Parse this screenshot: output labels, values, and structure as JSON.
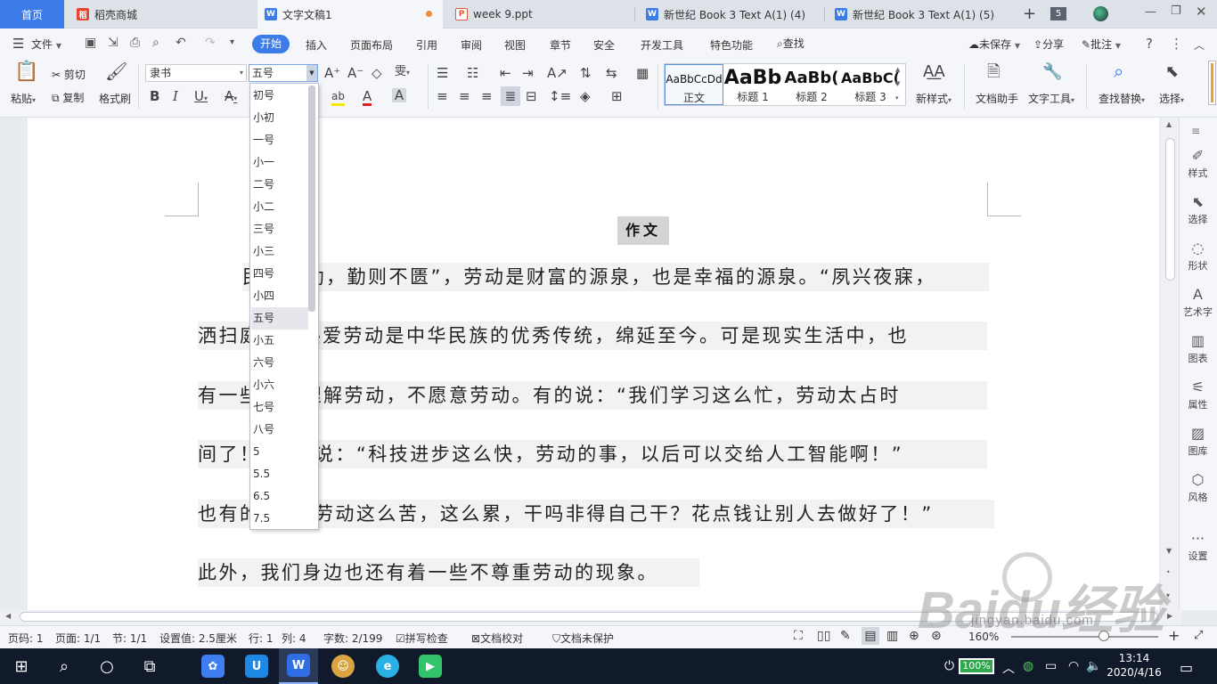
{
  "tabs": {
    "home": "首页",
    "daoke": "稻壳商城",
    "doc1": "文字文稿1",
    "ppt": "week 9.ppt",
    "book1": "新世纪 Book 3 Text A(1) (4)",
    "book2": "新世纪 Book 3 Text A(1) (5)",
    "new_tab": "+",
    "count": "5"
  },
  "menu": {
    "file": "文件",
    "start": "开始",
    "insert": "插入",
    "layout": "页面布局",
    "reference": "引用",
    "review": "审阅",
    "view": "视图",
    "chapter": "章节",
    "security": "安全",
    "dev": "开发工具",
    "special": "特色功能",
    "search": "查找",
    "unsaved": "未保存",
    "share": "分享",
    "annotate": "批注"
  },
  "ribbon": {
    "paste": "粘贴",
    "cut": "剪切",
    "copy": "复制",
    "format_painter": "格式刷",
    "font_name": "隶书",
    "font_size": "五号",
    "styles": [
      {
        "sample": "AaBbCcDd",
        "name": "正文"
      },
      {
        "sample": "AaBb",
        "name": "标题 1"
      },
      {
        "sample": "AaBb(",
        "name": "标题 2"
      },
      {
        "sample": "AaBbC(",
        "name": "标题 3"
      }
    ],
    "new_style": "新样式",
    "doc_helper": "文档助手",
    "text_tools": "文字工具",
    "find_replace": "查找替换",
    "select": "选择"
  },
  "font_size_options": [
    "初号",
    "小初",
    "一号",
    "小一",
    "二号",
    "小二",
    "三号",
    "小三",
    "四号",
    "小四",
    "五号",
    "小五",
    "六号",
    "小六",
    "七号",
    "八号",
    "5",
    "5.5",
    "6.5",
    "7.5"
  ],
  "document": {
    "title": "作文",
    "paragraphs": [
      "民生在勤，勤则不匮”，劳动是财富的源泉，也是幸福的源泉。“夙兴夜寐，",
      "洒扫庭内” 热爱劳动是中华民族的优秀传统，绵延至今。可是现实生活中，也",
      "有一些人不理解劳动，不愿意劳动。有的说：“我们学习这么忙，劳动太占时",
      "间了！”有的说：“科技进步这么快，劳动的事，以后可以交给人工智能啊！”",
      "也有的说：“劳动这么苦，这么累，干吗非得自己干？花点钱让别人去做好了！”",
      "此外，我们身边也还有着一些不尊重劳动的现象。"
    ]
  },
  "side_panel": [
    "样式",
    "选择",
    "形状",
    "艺术字",
    "图表",
    "属性",
    "图库",
    "风格",
    "设置"
  ],
  "status": {
    "page": "页码: 1",
    "pages": "页面: 1/1",
    "section": "节: 1/1",
    "setting": "设置值: 2.5厘米",
    "row": "行: 1",
    "col": "列: 4",
    "words": "字数: 2/199",
    "spell": "拼写检查",
    "proof": "文档校对",
    "protect": "文档未保护",
    "zoom": "160%"
  },
  "taskbar": {
    "battery": "100%",
    "time": "13:14",
    "date": "2020/4/16"
  },
  "watermark": {
    "logo": "Baidu经验",
    "url": "jingyan.baidu.com"
  },
  "colors": {
    "accent": "#3c7ce8",
    "taskbar": "#101a2b",
    "highlight": "#f2f2f2"
  }
}
